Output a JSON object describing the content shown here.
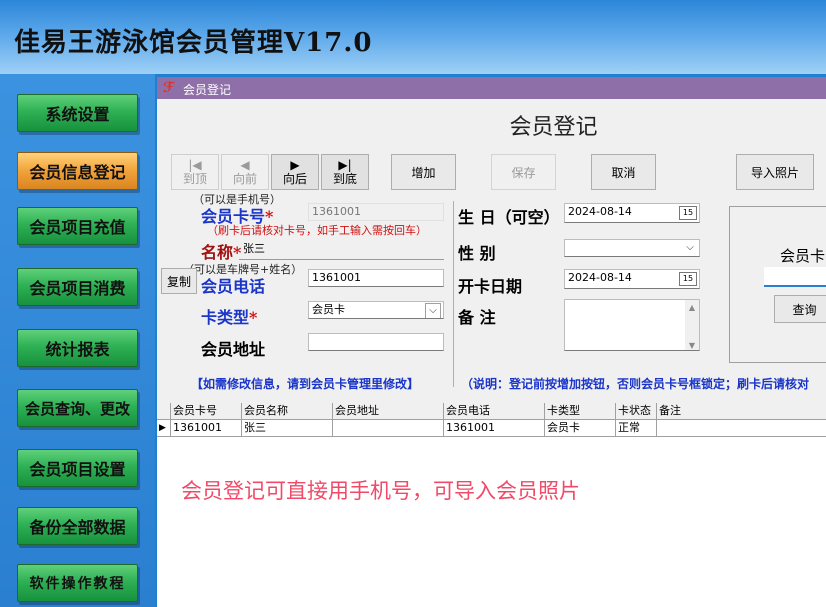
{
  "app": {
    "title": "佳易王游泳馆会员管理V17.0"
  },
  "sidebar": {
    "items": [
      {
        "label": "系统设置"
      },
      {
        "label": "会员信息登记"
      },
      {
        "label": "会员项目充值"
      },
      {
        "label": "会员项目消费"
      },
      {
        "label": "统计报表"
      },
      {
        "label": "会员查询、更改"
      },
      {
        "label": "会员项目设置"
      },
      {
        "label": "备份全部数据"
      },
      {
        "label": "软件操作教程"
      }
    ],
    "active_index": 1
  },
  "window": {
    "title": "会员登记",
    "form_title": "会员登记"
  },
  "toolbar": {
    "first": {
      "icon": "|◀",
      "label": "到顶"
    },
    "prev": {
      "icon": "◀",
      "label": "向前"
    },
    "next": {
      "icon": "▶",
      "label": "向后"
    },
    "last": {
      "icon": "▶|",
      "label": "到底"
    },
    "add": "增加",
    "save": "保存",
    "cancel": "取消",
    "import_photo": "导入照片"
  },
  "form": {
    "card_hint": "（可以是手机号）",
    "card_label": "会员卡号",
    "card_value": "1361001",
    "card_note": "（刷卡后请核对卡号，如手工输入需按回车）",
    "name_label": "名称",
    "name_value": "张三",
    "phone_hint": "（可以是车牌号+姓名）",
    "copy_button": "复制",
    "phone_label": "会员电话",
    "phone_value": "1361001",
    "type_label": "卡类型",
    "type_value": "会员卡",
    "address_label": "会员地址",
    "address_value": "",
    "required_mark": "*",
    "birthday_label": "生 日（可空）",
    "birthday_value": "2024-08-14",
    "gender_label": "性    别",
    "gender_value": "",
    "open_date_label": "开卡日期",
    "open_date_value": "2024-08-14",
    "notes_label": "备    注",
    "notes_value": "",
    "photo_label": "会员卡",
    "query_button": "查询"
  },
  "info": {
    "left": "【如需修改信息，请到会员卡管理里修改】",
    "right": "（说明：登记前按增加按钮，否则会员卡号框锁定；刷卡后请核对"
  },
  "grid": {
    "columns": [
      "会员卡号",
      "会员名称",
      "会员地址",
      "会员电话",
      "卡类型",
      "卡状态",
      "备注"
    ],
    "rows": [
      [
        "1361001",
        "张三",
        "",
        "1361001",
        "会员卡",
        "正常",
        ""
      ]
    ]
  },
  "promo": "会员登记可直接用手机号，可导入会员照片",
  "colors": {
    "accent_purple": "#8f6fa8",
    "label_blue": "#1a35c8",
    "promo_pink": "#f04a68"
  }
}
